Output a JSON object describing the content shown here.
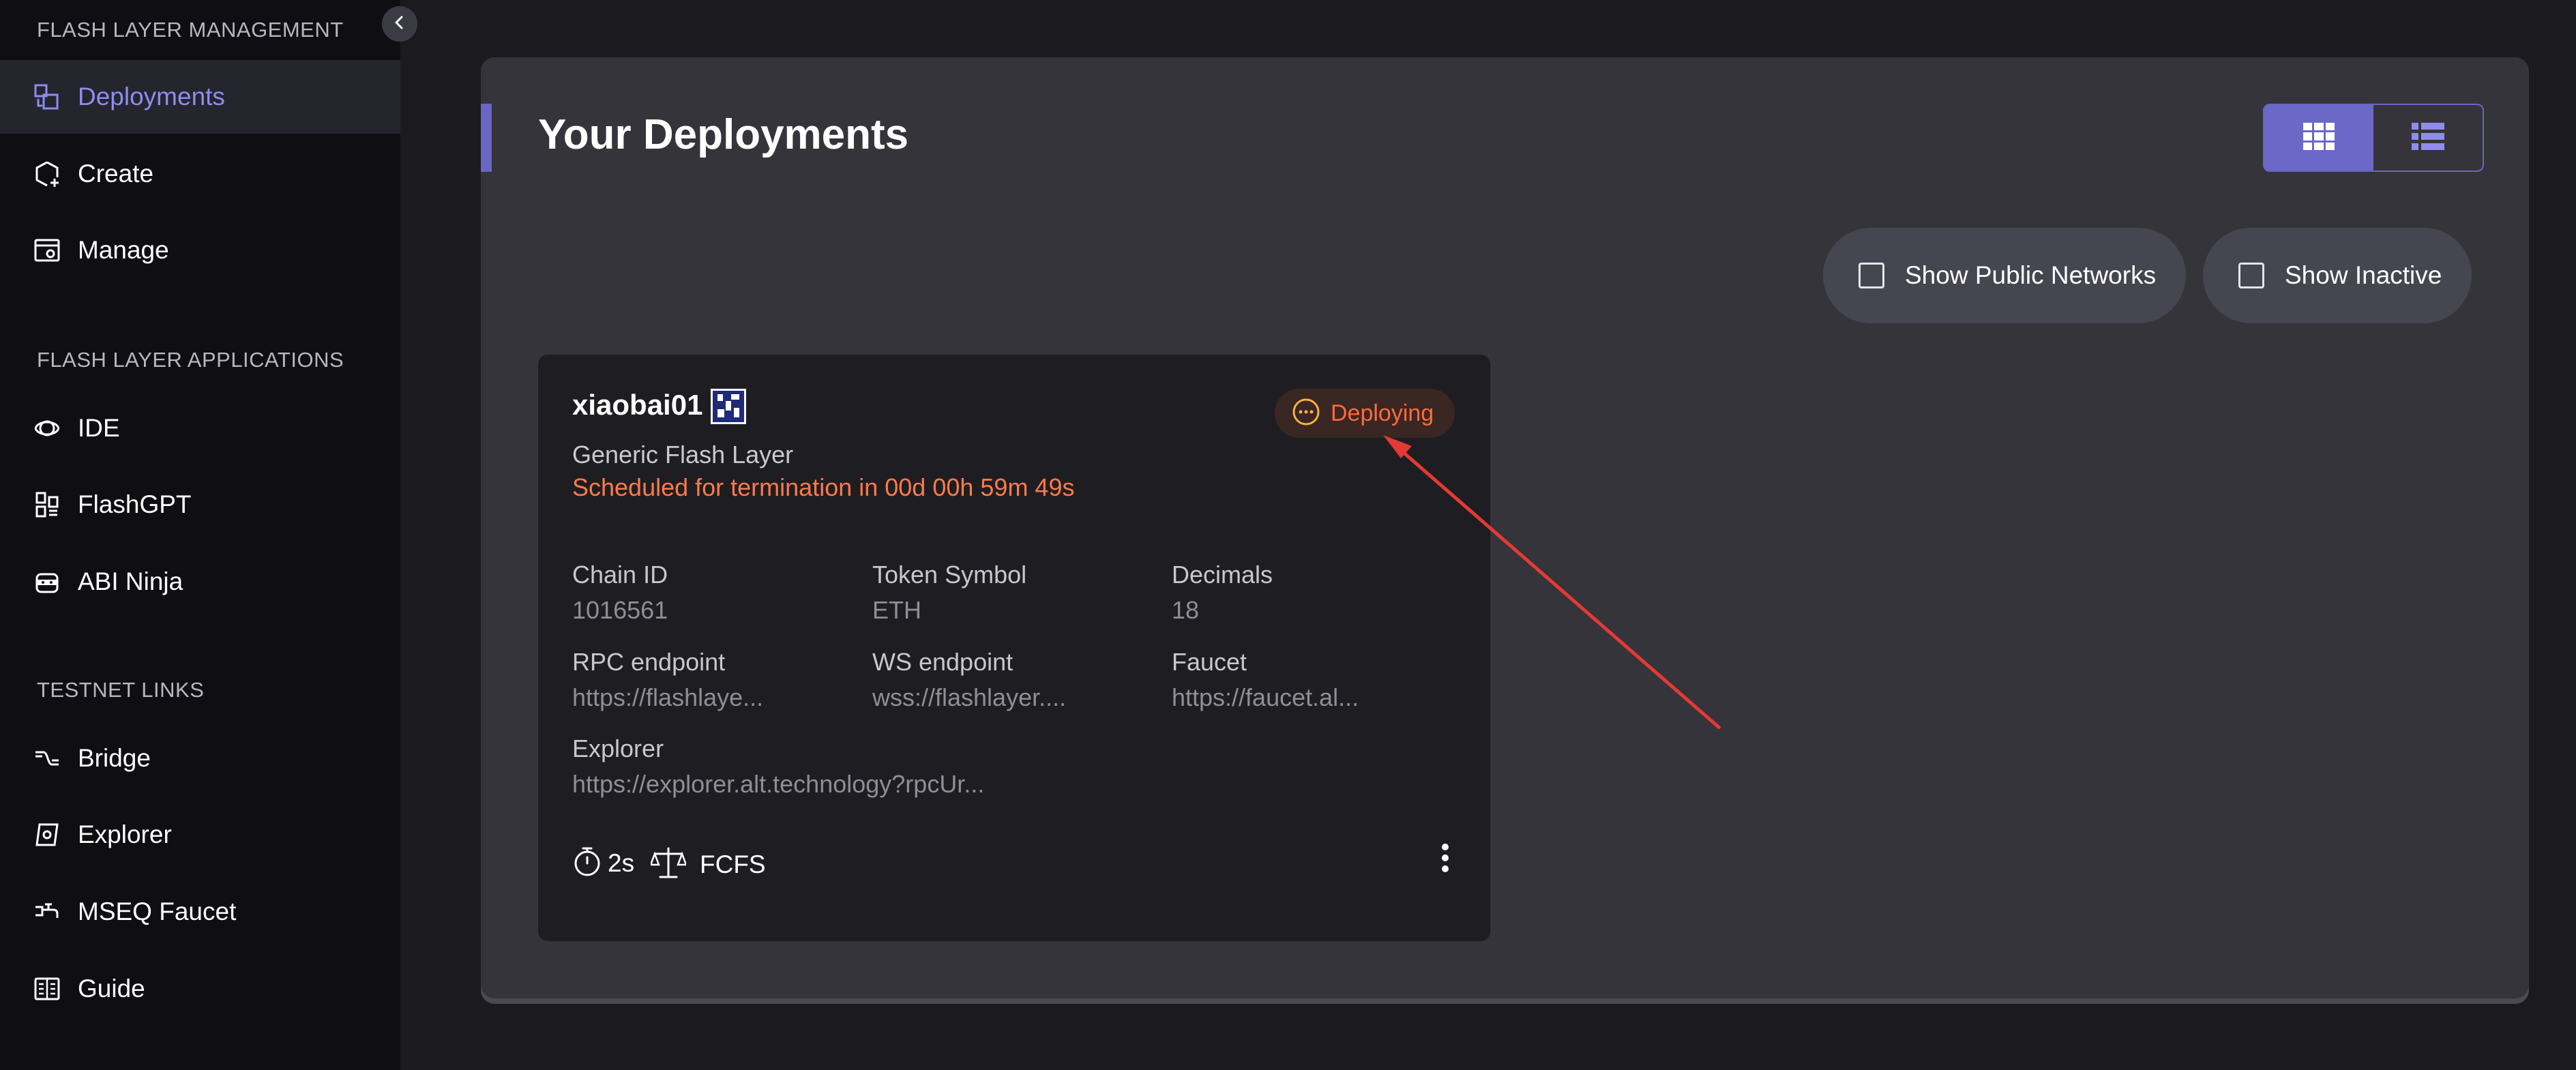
{
  "sidebar": {
    "sections": [
      {
        "title": "FLASH LAYER MANAGEMENT"
      },
      {
        "title": "FLASH LAYER APPLICATIONS"
      },
      {
        "title": "TESTNET LINKS"
      }
    ],
    "items": [
      {
        "label": "Deployments",
        "icon": "deployments-icon",
        "active": true
      },
      {
        "label": "Create",
        "icon": "create-icon"
      },
      {
        "label": "Manage",
        "icon": "manage-icon"
      },
      {
        "label": "IDE",
        "icon": "ide-icon"
      },
      {
        "label": "FlashGPT",
        "icon": "flashgpt-icon"
      },
      {
        "label": "ABI Ninja",
        "icon": "abi-ninja-icon"
      },
      {
        "label": "Bridge",
        "icon": "bridge-icon"
      },
      {
        "label": "Explorer",
        "icon": "explorer-icon"
      },
      {
        "label": "MSEQ Faucet",
        "icon": "faucet-icon"
      },
      {
        "label": "Guide",
        "icon": "guide-icon"
      }
    ]
  },
  "main": {
    "title": "Your Deployments",
    "view_modes": [
      "grid-view-icon",
      "list-view-icon"
    ],
    "selected_view": "grid",
    "filters": [
      {
        "label": "Show Public Networks",
        "checked": false
      },
      {
        "label": "Show Inactive",
        "checked": false
      }
    ]
  },
  "card": {
    "name": "xiaobai01",
    "status": "Deploying",
    "type": "Generic Flash Layer",
    "termination": "Scheduled for termination in 00d 00h 59m 49s",
    "fields": [
      {
        "label": "Chain ID",
        "value": "1016561"
      },
      {
        "label": "Token Symbol",
        "value": "ETH"
      },
      {
        "label": "Decimals",
        "value": "18"
      },
      {
        "label": "RPC endpoint",
        "value": "https://flashlaye..."
      },
      {
        "label": "WS endpoint",
        "value": "wss://flashlayer...."
      },
      {
        "label": "Faucet",
        "value": "https://faucet.al..."
      },
      {
        "label": "Explorer",
        "value": "https://explorer.alt.technology?rpcUr..."
      }
    ],
    "block_time": "2s",
    "sequencer": "FCFS"
  },
  "colors": {
    "accent": "#6b68c8",
    "status_deploying": "#ff6a3d",
    "termination_text": "#ff7a4a",
    "annotation_arrow": "#e53935"
  }
}
